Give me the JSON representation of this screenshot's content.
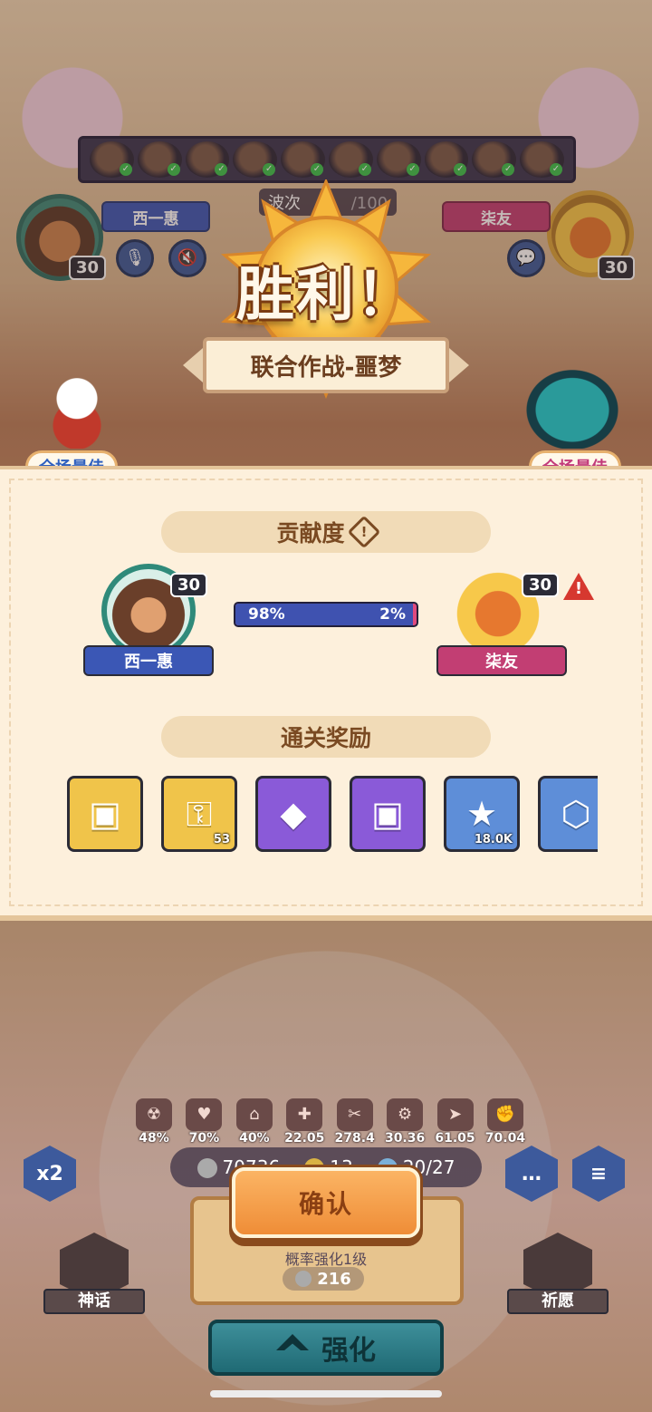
{
  "top": {
    "unit_count": 10,
    "left_player": {
      "name": "西一惠",
      "level": "30"
    },
    "right_player": {
      "name": "柒友",
      "level": "30"
    },
    "wave_label": "波次",
    "wave_total": "/100"
  },
  "result": {
    "title": "胜利！",
    "mode": "联合作战-噩梦",
    "mvp_badge": "全场最佳"
  },
  "contribution": {
    "heading": "贡献度",
    "info_glyph": "!",
    "left": {
      "name": "西一惠",
      "level": "30",
      "percent": "98%",
      "fraction": 0.98
    },
    "right": {
      "name": "柒友",
      "level": "30",
      "percent": "2%",
      "warning": "!"
    }
  },
  "rewards": {
    "heading": "通关奖励",
    "items": [
      {
        "icon": "treasure-chest-icon",
        "glyph": "▣",
        "count": ""
      },
      {
        "icon": "key-icon",
        "glyph": "⚿",
        "count": "53"
      },
      {
        "icon": "crystal-icon",
        "glyph": "◆",
        "count": ""
      },
      {
        "icon": "purple-chest-icon",
        "glyph": "▣",
        "count": ""
      },
      {
        "icon": "gold-coin-icon",
        "glyph": "★",
        "count": "18.0K"
      },
      {
        "icon": "emblem-icon",
        "glyph": "⬡",
        "count": ""
      }
    ]
  },
  "hud": {
    "stats": [
      "48%",
      "70%",
      "40%",
      "22.05",
      "278.4",
      "30.36",
      "61.05",
      "70.04"
    ],
    "resource_1": "70736",
    "resource_2": "13",
    "resource_3": "20/27",
    "speed_label": "x2",
    "chat_glyph": "…",
    "menu_glyph": "≡",
    "upgrade_label": "概率强化1级",
    "upgrade_cost": "216",
    "left_button": "神话",
    "right_button": "祈愿",
    "enhance_button": "强化",
    "confirm_button": "确认"
  }
}
